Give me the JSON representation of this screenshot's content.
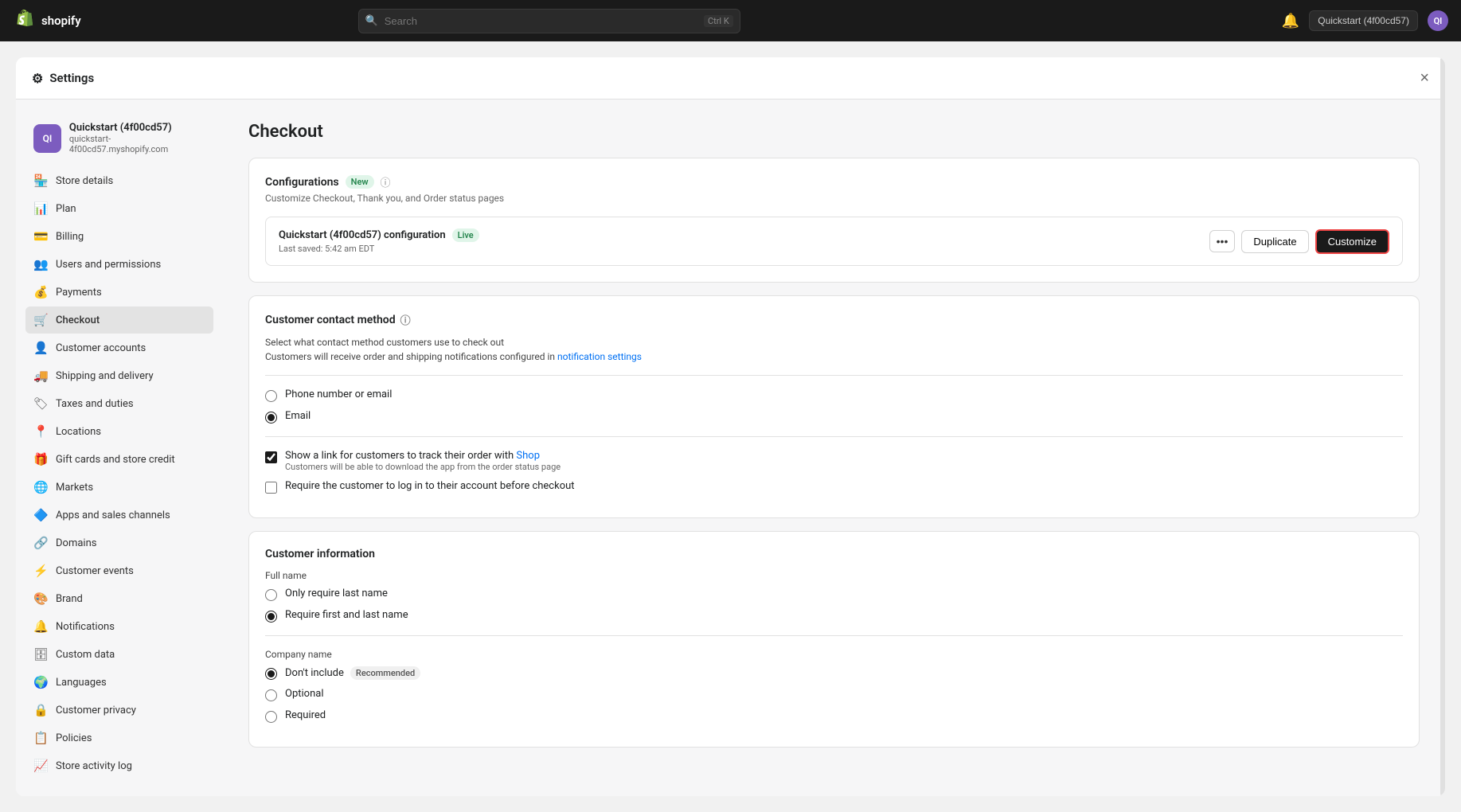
{
  "topnav": {
    "logo_text": "shopify",
    "search_placeholder": "Search",
    "search_shortcut": "Ctrl K",
    "store_label": "Quickstart (4f00cd57)",
    "avatar_initials": "QI"
  },
  "settings_header": {
    "title": "Settings",
    "close_label": "×"
  },
  "sidebar": {
    "store_name": "Quickstart (4f00cd57)",
    "store_domain": "quickstart-4f00cd57.myshopify.com",
    "store_avatar_initials": "QI",
    "items": [
      {
        "id": "store-details",
        "label": "Store details",
        "icon": "🏪"
      },
      {
        "id": "plan",
        "label": "Plan",
        "icon": "📊"
      },
      {
        "id": "billing",
        "label": "Billing",
        "icon": "💳"
      },
      {
        "id": "users-permissions",
        "label": "Users and permissions",
        "icon": "👥"
      },
      {
        "id": "payments",
        "label": "Payments",
        "icon": "💰"
      },
      {
        "id": "checkout",
        "label": "Checkout",
        "icon": "🛒",
        "active": true
      },
      {
        "id": "customer-accounts",
        "label": "Customer accounts",
        "icon": "👤"
      },
      {
        "id": "shipping-delivery",
        "label": "Shipping and delivery",
        "icon": "🚚"
      },
      {
        "id": "taxes-duties",
        "label": "Taxes and duties",
        "icon": "🏷"
      },
      {
        "id": "locations",
        "label": "Locations",
        "icon": "📍"
      },
      {
        "id": "gift-cards",
        "label": "Gift cards and store credit",
        "icon": "🎁"
      },
      {
        "id": "markets",
        "label": "Markets",
        "icon": "🌐"
      },
      {
        "id": "apps-sales-channels",
        "label": "Apps and sales channels",
        "icon": "🔷"
      },
      {
        "id": "domains",
        "label": "Domains",
        "icon": "🔗"
      },
      {
        "id": "customer-events",
        "label": "Customer events",
        "icon": "⚡"
      },
      {
        "id": "brand",
        "label": "Brand",
        "icon": "🎨"
      },
      {
        "id": "notifications",
        "label": "Notifications",
        "icon": "🔔"
      },
      {
        "id": "custom-data",
        "label": "Custom data",
        "icon": "🗄"
      },
      {
        "id": "languages",
        "label": "Languages",
        "icon": "🌍"
      },
      {
        "id": "customer-privacy",
        "label": "Customer privacy",
        "icon": "🔒"
      },
      {
        "id": "policies",
        "label": "Policies",
        "icon": "📋"
      },
      {
        "id": "store-activity-log",
        "label": "Store activity log",
        "icon": "📈"
      }
    ]
  },
  "main": {
    "page_title": "Checkout",
    "configurations_card": {
      "title": "Configurations",
      "badge_new": "New",
      "info_icon": "ⓘ",
      "subtitle": "Customize Checkout, Thank you, and Order status pages",
      "config_name": "Quickstart (4f00cd57) configuration",
      "config_badge": "Live",
      "last_saved": "Last saved: 5:42 am EDT",
      "dots_label": "•••",
      "duplicate_label": "Duplicate",
      "customize_label": "Customize"
    },
    "contact_method_card": {
      "title": "Customer contact method",
      "info_icon": "ⓘ",
      "select_label": "Select what contact method customers use to check out",
      "notify_text": "Customers will receive order and shipping notifications configured in ",
      "notify_link": "notification settings",
      "options": [
        {
          "id": "phone-or-email",
          "label": "Phone number or email",
          "checked": false
        },
        {
          "id": "email",
          "label": "Email",
          "checked": true
        }
      ],
      "checkbox_shop_label": "Show a link for customers to track their order with ",
      "checkbox_shop_link": "Shop",
      "checkbox_shop_sub": "Customers will be able to download the app from the order status page",
      "checkbox_shop_checked": true,
      "checkbox_login_label": "Require the customer to log in to their account before checkout",
      "checkbox_login_checked": false
    },
    "customer_info_card": {
      "title": "Customer information",
      "full_name_label": "Full name",
      "full_name_options": [
        {
          "id": "only-last-name",
          "label": "Only require last name",
          "checked": false
        },
        {
          "id": "first-and-last",
          "label": "Require first and last name",
          "checked": true
        }
      ],
      "company_name_label": "Company name",
      "company_name_options": [
        {
          "id": "dont-include",
          "label": "Don't include",
          "badge": "Recommended",
          "checked": true
        },
        {
          "id": "optional",
          "label": "Optional",
          "checked": false
        },
        {
          "id": "required",
          "label": "Required",
          "checked": false
        }
      ]
    }
  }
}
